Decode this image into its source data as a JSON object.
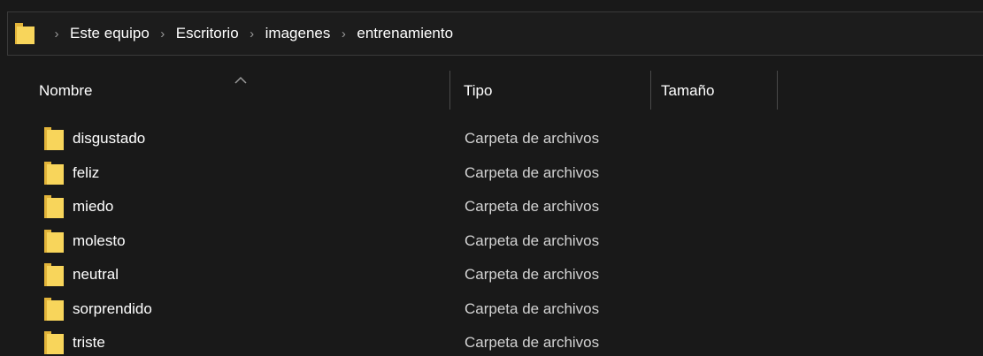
{
  "address_bar": {
    "icon": "folder-icon",
    "separator": "›",
    "breadcrumbs": [
      "Este equipo",
      "Escritorio",
      "imagenes",
      "entrenamiento"
    ]
  },
  "columns": {
    "sort_icon": "chevron-up-icon",
    "name": "Nombre",
    "type": "Tipo",
    "size": "Tamaño"
  },
  "colors": {
    "background": "#191919",
    "folder_yellow": "#f8d55b",
    "folder_dark": "#e2b43a",
    "text": "#ffffff",
    "secondary_text": "#d2d2d2"
  },
  "files": [
    {
      "name": "disgustado",
      "type": "Carpeta de archivos",
      "size": "",
      "icon": "folder-icon"
    },
    {
      "name": "feliz",
      "type": "Carpeta de archivos",
      "size": "",
      "icon": "folder-icon"
    },
    {
      "name": "miedo",
      "type": "Carpeta de archivos",
      "size": "",
      "icon": "folder-icon"
    },
    {
      "name": "molesto",
      "type": "Carpeta de archivos",
      "size": "",
      "icon": "folder-icon"
    },
    {
      "name": "neutral",
      "type": "Carpeta de archivos",
      "size": "",
      "icon": "folder-icon"
    },
    {
      "name": "sorprendido",
      "type": "Carpeta de archivos",
      "size": "",
      "icon": "folder-icon"
    },
    {
      "name": "triste",
      "type": "Carpeta de archivos",
      "size": "",
      "icon": "folder-icon"
    }
  ]
}
